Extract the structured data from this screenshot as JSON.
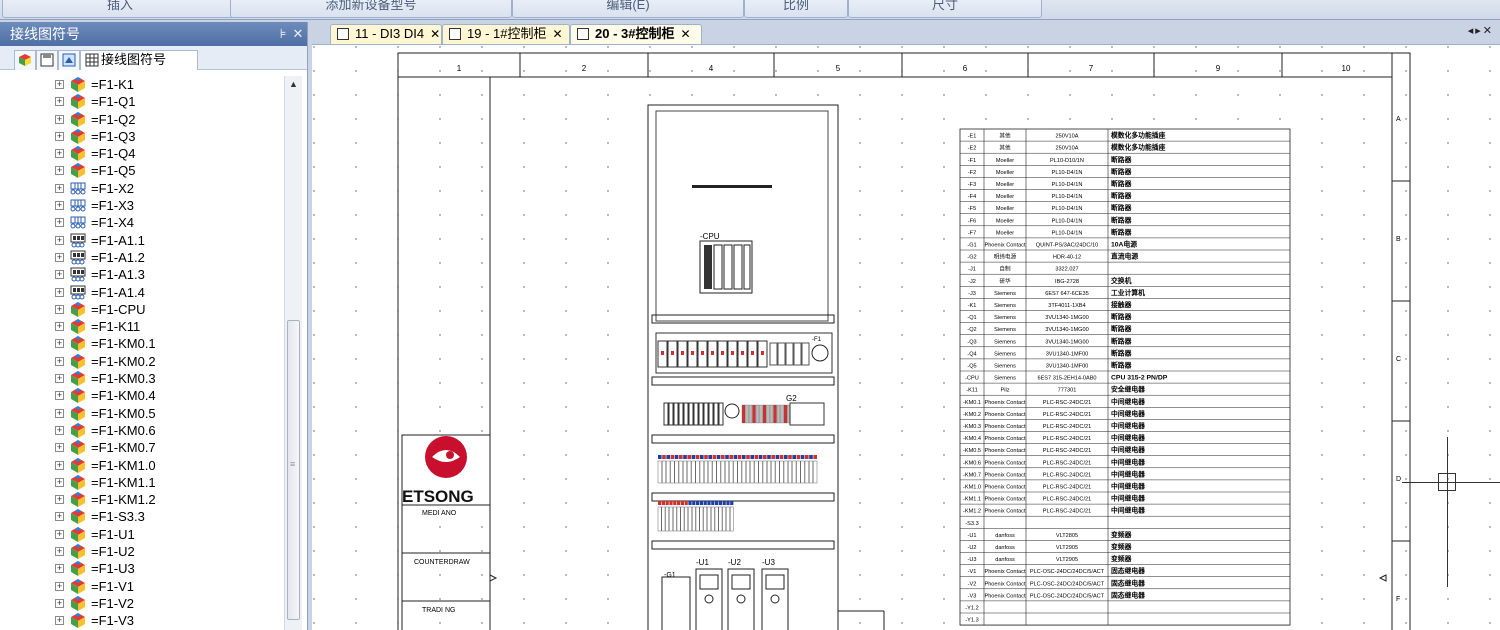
{
  "ribbon": {
    "groups": [
      "插入",
      "添加新设备型号",
      "编辑(E)",
      "比例",
      "尺寸"
    ]
  },
  "panel": {
    "title": "接线图符号",
    "pin_icon": "pin-icon",
    "close_icon": "close-icon",
    "tab_label": "接线图符号",
    "items": [
      {
        "label": "=F1-K1",
        "icon": "device-icon"
      },
      {
        "label": "=F1-Q1",
        "icon": "device-icon"
      },
      {
        "label": "=F1-Q2",
        "icon": "device-icon"
      },
      {
        "label": "=F1-Q3",
        "icon": "device-icon"
      },
      {
        "label": "=F1-Q4",
        "icon": "device-icon"
      },
      {
        "label": "=F1-Q5",
        "icon": "device-icon"
      },
      {
        "label": "=F1-X2",
        "icon": "terminal-icon"
      },
      {
        "label": "=F1-X3",
        "icon": "terminal-icon"
      },
      {
        "label": "=F1-X4",
        "icon": "terminal-icon"
      },
      {
        "label": "=F1-A1.1",
        "icon": "module-icon"
      },
      {
        "label": "=F1-A1.2",
        "icon": "module-icon"
      },
      {
        "label": "=F1-A1.3",
        "icon": "module-icon"
      },
      {
        "label": "=F1-A1.4",
        "icon": "module-icon"
      },
      {
        "label": "=F1-CPU",
        "icon": "device-icon"
      },
      {
        "label": "=F1-K11",
        "icon": "device-icon"
      },
      {
        "label": "=F1-KM0.1",
        "icon": "device-icon"
      },
      {
        "label": "=F1-KM0.2",
        "icon": "device-icon"
      },
      {
        "label": "=F1-KM0.3",
        "icon": "device-icon"
      },
      {
        "label": "=F1-KM0.4",
        "icon": "device-icon"
      },
      {
        "label": "=F1-KM0.5",
        "icon": "device-icon"
      },
      {
        "label": "=F1-KM0.6",
        "icon": "device-icon"
      },
      {
        "label": "=F1-KM0.7",
        "icon": "device-icon"
      },
      {
        "label": "=F1-KM1.0",
        "icon": "device-icon"
      },
      {
        "label": "=F1-KM1.1",
        "icon": "device-icon"
      },
      {
        "label": "=F1-KM1.2",
        "icon": "device-icon"
      },
      {
        "label": "=F1-S3.3",
        "icon": "device-icon"
      },
      {
        "label": "=F1-U1",
        "icon": "device-icon"
      },
      {
        "label": "=F1-U2",
        "icon": "device-icon"
      },
      {
        "label": "=F1-U3",
        "icon": "device-icon"
      },
      {
        "label": "=F1-V1",
        "icon": "device-icon"
      },
      {
        "label": "=F1-V2",
        "icon": "device-icon"
      },
      {
        "label": "=F1-V3",
        "icon": "device-icon"
      }
    ]
  },
  "doctabs": [
    {
      "label": "11 - DI3 DI4",
      "active": false
    },
    {
      "label": "19 - 1#控制柜",
      "active": false
    },
    {
      "label": "20 - 3#控制柜",
      "active": true
    }
  ],
  "drawing": {
    "columns": [
      "1",
      "2",
      "4",
      "5",
      "6",
      "7",
      "9",
      "10"
    ],
    "rows": [
      "A",
      "B",
      "C",
      "D",
      "F"
    ],
    "logo_text": "ETSONG",
    "title_block": [
      "MEDI ANO",
      "COUNTERDRAW",
      "TRADI NG"
    ],
    "cabinet_labels": {
      "cpu": "-CPU",
      "g2": "G2",
      "g1": "-G1",
      "u1": "-U1",
      "u2": "-U2",
      "u3": "-U3",
      "f1": "-F1"
    },
    "parts_table": [
      [
        "-E1",
        "其他",
        "250V10A",
        "模数化多功能插座"
      ],
      [
        "-E2",
        "其他",
        "250V10A",
        "模数化多功能插座"
      ],
      [
        "-F1",
        "Moeller",
        "PL10-D10/1N",
        "断路器"
      ],
      [
        "-F2",
        "Moeller",
        "PL10-D4/1N",
        "断路器"
      ],
      [
        "-F3",
        "Moeller",
        "PL10-D4/1N",
        "断路器"
      ],
      [
        "-F4",
        "Moeller",
        "PL10-D4/1N",
        "断路器"
      ],
      [
        "-F5",
        "Moeller",
        "PL10-D4/1N",
        "断路器"
      ],
      [
        "-F6",
        "Moeller",
        "PL10-D4/1N",
        "断路器"
      ],
      [
        "-F7",
        "Moeller",
        "PL10-D4/1N",
        "断路器"
      ],
      [
        "-G1",
        "Phoenix Contact",
        "QUINT-PS/3AC/24DC/10",
        "10A电源"
      ],
      [
        "-G2",
        "明纬电源",
        "HDR-40-12",
        "直流电源"
      ],
      [
        "-J1",
        "自制",
        "3322.027",
        ""
      ],
      [
        "-J2",
        "研华",
        "IBG-2728",
        "交换机"
      ],
      [
        "-J3",
        "Siemens",
        "6ES7 647-6CE35",
        "工业计算机"
      ],
      [
        "-K1",
        "Siemens",
        "3TF4011-1XB4",
        "接触器"
      ],
      [
        "-Q1",
        "Siemens",
        "3VU1340-1MG00",
        "断路器"
      ],
      [
        "-Q2",
        "Siemens",
        "3VU1340-1MG00",
        "断路器"
      ],
      [
        "-Q3",
        "Siemens",
        "3VU1340-1MG00",
        "断路器"
      ],
      [
        "-Q4",
        "Siemens",
        "3VU1340-1MF00",
        "断路器"
      ],
      [
        "-Q5",
        "Siemens",
        "3VU1340-1MF00",
        "断路器"
      ],
      [
        "-CPU",
        "Siemens",
        "6ES7 315-2EH14-0AB0",
        "CPU 315-2 PN/DP"
      ],
      [
        "-K11",
        "Pilz",
        "777301",
        "安全继电器"
      ],
      [
        "-KM0.1",
        "Phoenix Contact",
        "PLC-RSC-24DC/21",
        "中间继电器"
      ],
      [
        "-KM0.2",
        "Phoenix Contact",
        "PLC-RSC-24DC/21",
        "中间继电器"
      ],
      [
        "-KM0.3",
        "Phoenix Contact",
        "PLC-RSC-24DC/21",
        "中间继电器"
      ],
      [
        "-KM0.4",
        "Phoenix Contact",
        "PLC-RSC-24DC/21",
        "中间继电器"
      ],
      [
        "-KM0.5",
        "Phoenix Contact",
        "PLC-RSC-24DC/21",
        "中间继电器"
      ],
      [
        "-KM0.6",
        "Phoenix Contact",
        "PLC-RSC-24DC/21",
        "中间继电器"
      ],
      [
        "-KM0.7",
        "Phoenix Contact",
        "PLC-RSC-24DC/21",
        "中间继电器"
      ],
      [
        "-KM1.0",
        "Phoenix Contact",
        "PLC-RSC-24DC/21",
        "中间继电器"
      ],
      [
        "-KM1.1",
        "Phoenix Contact",
        "PLC-RSC-24DC/21",
        "中间继电器"
      ],
      [
        "-KM1.2",
        "Phoenix Contact",
        "PLC-RSC-24DC/21",
        "中间继电器"
      ],
      [
        "-S3.3",
        "",
        "",
        ""
      ],
      [
        "-U1",
        "danfoss",
        "VLT2805",
        "变频器"
      ],
      [
        "-U2",
        "danfoss",
        "VLT2905",
        "变频器"
      ],
      [
        "-U3",
        "danfoss",
        "VLT2905",
        "变频器"
      ],
      [
        "-V1",
        "Phoenix Contact",
        "PLC-OSC-24DC/24DC/5/ACT",
        "固态继电器"
      ],
      [
        "-V2",
        "Phoenix Contact",
        "PLC-OSC-24DC/24DC/5/ACT",
        "固态继电器"
      ],
      [
        "-V3",
        "Phoenix Contact",
        "PLC-OSC-24DC/24DC/5/ACT",
        "固态继电器"
      ],
      [
        "-Y1.2",
        "",
        "",
        ""
      ],
      [
        "-Y1.3",
        "",
        "",
        ""
      ]
    ]
  },
  "colors": {
    "accent": "#4e6fa4",
    "logo_red": "#c8102e",
    "panel_bg": "#c9d3e3"
  }
}
